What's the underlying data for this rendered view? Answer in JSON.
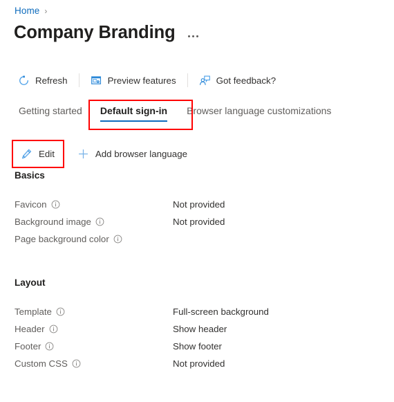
{
  "breadcrumb": {
    "items": [
      {
        "label": "Home",
        "icon": "none"
      }
    ],
    "separator": "›"
  },
  "header": {
    "title": "Company Branding",
    "more_label": "…",
    "more_icon": "ellipsis-icon"
  },
  "commandbar": {
    "items": [
      {
        "label": "Refresh",
        "icon": "refresh-icon"
      },
      {
        "label": "Preview features",
        "icon": "preview-features-icon"
      },
      {
        "label": "Got feedback?",
        "icon": "feedback-icon"
      }
    ]
  },
  "tabs": {
    "items": [
      {
        "label": "Getting started",
        "selected": false
      },
      {
        "label": "Default sign-in",
        "selected": true
      },
      {
        "label": "Browser language customizations",
        "selected": false
      }
    ]
  },
  "actionbar": {
    "items": [
      {
        "label": "Edit",
        "icon": "pencil-icon"
      },
      {
        "label": "Add browser language",
        "icon": "plus-icon"
      }
    ]
  },
  "sections": [
    {
      "title": "Basics",
      "rows": [
        {
          "label": "Favicon",
          "info_icon": "info-icon",
          "value": "Not provided"
        },
        {
          "label": "Background image",
          "info_icon": "info-icon",
          "value": "Not provided"
        },
        {
          "label": "Page background color",
          "info_icon": "info-icon",
          "value": ""
        }
      ]
    },
    {
      "title": "Layout",
      "rows": [
        {
          "label": "Template",
          "info_icon": "info-icon",
          "value": "Full-screen background"
        },
        {
          "label": "Header",
          "info_icon": "info-icon",
          "value": "Show header"
        },
        {
          "label": "Footer",
          "info_icon": "info-icon",
          "value": "Show footer"
        },
        {
          "label": "Custom CSS",
          "info_icon": "info-icon",
          "value": "Not provided"
        }
      ]
    }
  ],
  "annotations": [
    {
      "name": "default-sign-in-tab-highlight",
      "color": "#ff0000"
    },
    {
      "name": "edit-button-highlight",
      "color": "#ff0000"
    }
  ],
  "colors": {
    "accent": "#0f6cbd",
    "link": "#0f6cbd",
    "text_primary": "#201f1e",
    "text_secondary": "#605e5c",
    "annotation": "#ff0000",
    "background": "#ffffff"
  }
}
